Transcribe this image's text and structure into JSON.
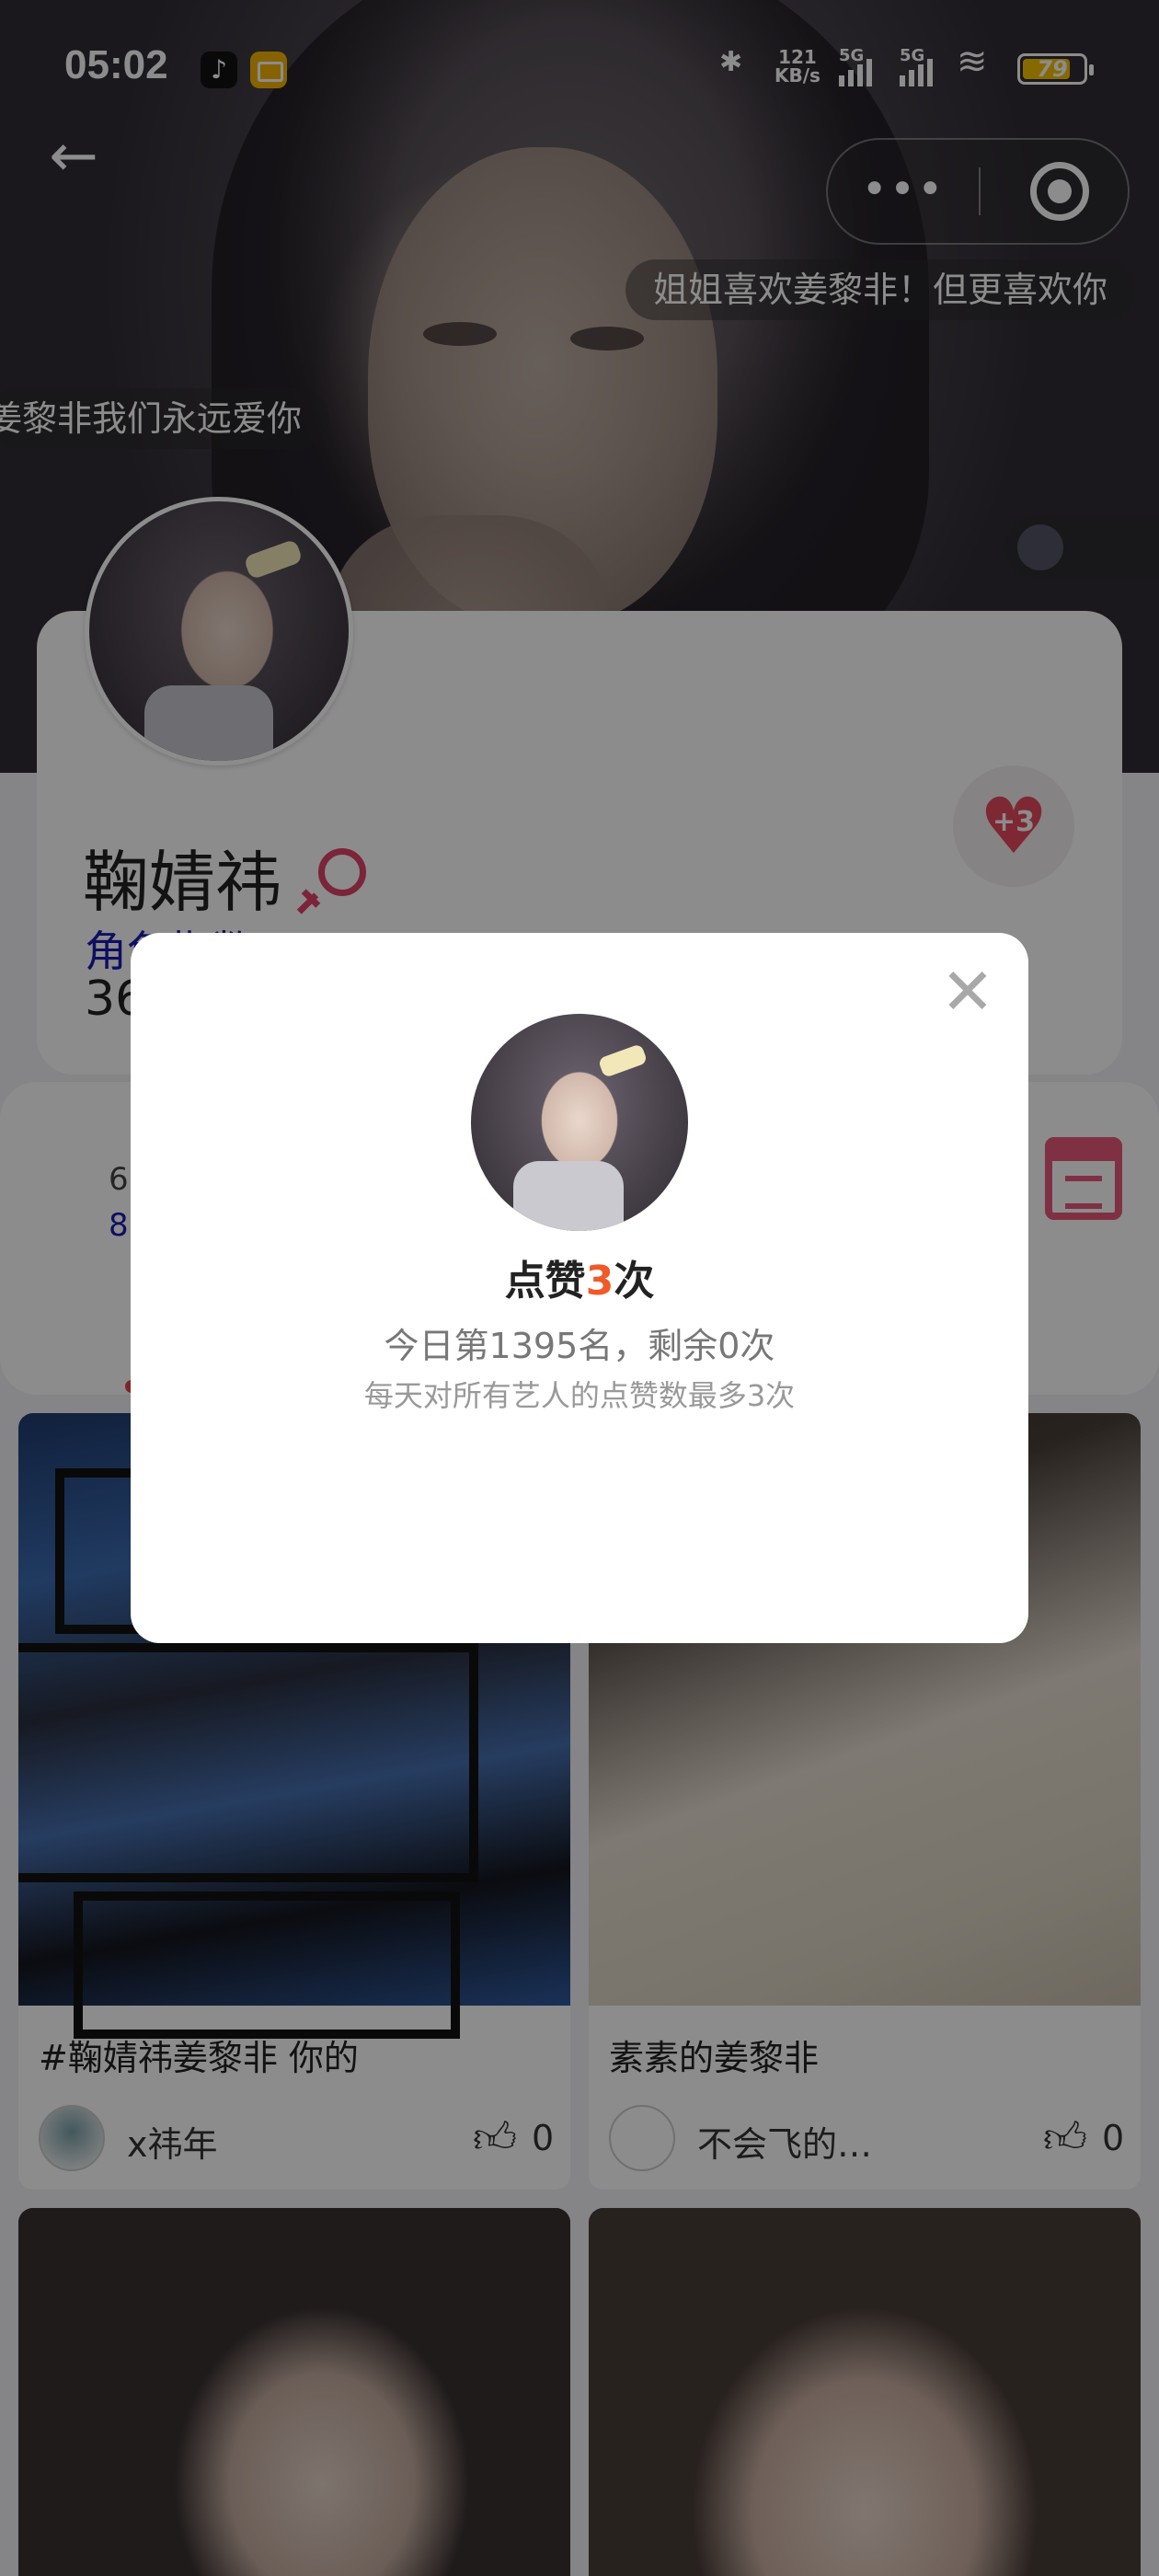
{
  "status_bar": {
    "time": "05:02",
    "net_speed_value": "121",
    "net_speed_unit": "KB/s",
    "signal1_label": "5G",
    "signal2_label": "5G",
    "battery": "79",
    "battery_level": 0.79
  },
  "danmaku": [
    "姐姐喜欢姜黎非！但更喜欢你",
    "姜黎非我们永远爱你"
  ],
  "profile": {
    "name": "鞠婧祎",
    "role_index_label": "角色指数",
    "role_index_value": "",
    "role_number": "36",
    "like_button": "+3",
    "gender_icon": "female-icon"
  },
  "stats": {
    "line_a": "6",
    "line_b": "8"
  },
  "posts": [
    {
      "caption": "#鞠婧祎姜黎非 你的",
      "author": "x祎年",
      "likes": "0"
    },
    {
      "caption": "素素的姜黎非",
      "author": "不会飞的…",
      "likes": "0"
    },
    {
      "caption": "",
      "author": "",
      "likes": ""
    },
    {
      "caption": "",
      "author": "",
      "likes": ""
    }
  ],
  "dialog": {
    "title_prefix": "点赞",
    "title_count": "3",
    "title_suffix": "次",
    "rank_text": "今日第1395名，剩余0次",
    "note_text": "每天对所有艺人的点赞数最多3次"
  },
  "colors": {
    "accent_red": "#e64a5e",
    "accent_orange": "#f05a28",
    "link_blue": "#1a1ab4"
  }
}
